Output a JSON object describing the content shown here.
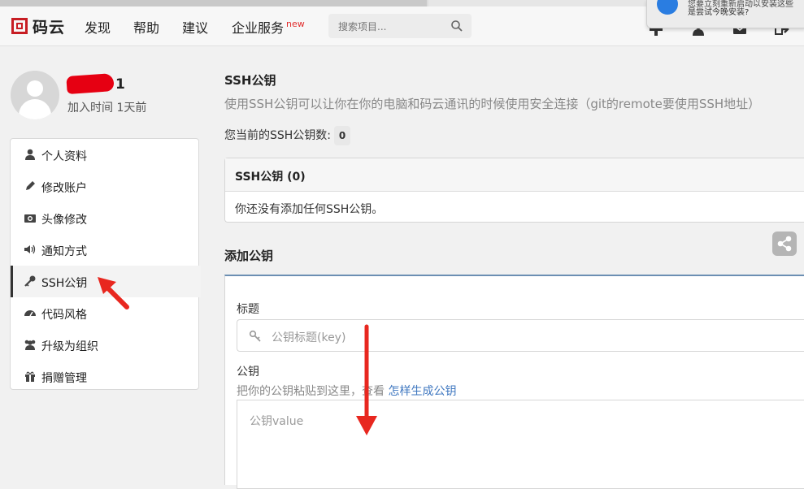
{
  "notification": {
    "line1": "您要立刻重新启动以安装这些",
    "line2": "是尝试今晚安装?"
  },
  "nav": {
    "logo_text": "码云",
    "items": [
      {
        "label": "发现"
      },
      {
        "label": "帮助"
      },
      {
        "label": "建议"
      },
      {
        "label": "企业服务",
        "badge": "new"
      }
    ],
    "search_placeholder": "搜索项目..."
  },
  "profile": {
    "username": "1",
    "joined": "加入时间 1天前"
  },
  "sidebar": {
    "items": [
      {
        "label": "个人资料",
        "icon": "user-icon"
      },
      {
        "label": "修改账户",
        "icon": "pencil-icon"
      },
      {
        "label": "头像修改",
        "icon": "camera-icon"
      },
      {
        "label": "通知方式",
        "icon": "volume-icon"
      },
      {
        "label": "SSH公钥",
        "icon": "key-icon",
        "active": true
      },
      {
        "label": "代码风格",
        "icon": "dashboard-icon"
      },
      {
        "label": "升级为组织",
        "icon": "users-icon"
      },
      {
        "label": "捐赠管理",
        "icon": "gift-icon"
      }
    ]
  },
  "main": {
    "title": "SSH公钥",
    "description": "使用SSH公钥可以让你在你的电脑和码云通讯的时候使用安全连接（git的remote要使用SSH地址）",
    "count_label": "您当前的SSH公钥数:",
    "count": "0",
    "panel_header": "SSH公钥 (0)",
    "panel_empty": "你还没有添加任何SSH公钥。",
    "add_title": "添加公钥",
    "form": {
      "title_label": "标题",
      "title_placeholder": "公钥标题(key)",
      "key_label": "公钥",
      "hint_text": "把你的公钥粘贴到这里，查看",
      "hint_link": "怎样生成公钥",
      "key_placeholder": "公钥value"
    }
  },
  "colors": {
    "brand": "#c71d23",
    "link": "#4078c0",
    "annotation": "#e8271f"
  }
}
